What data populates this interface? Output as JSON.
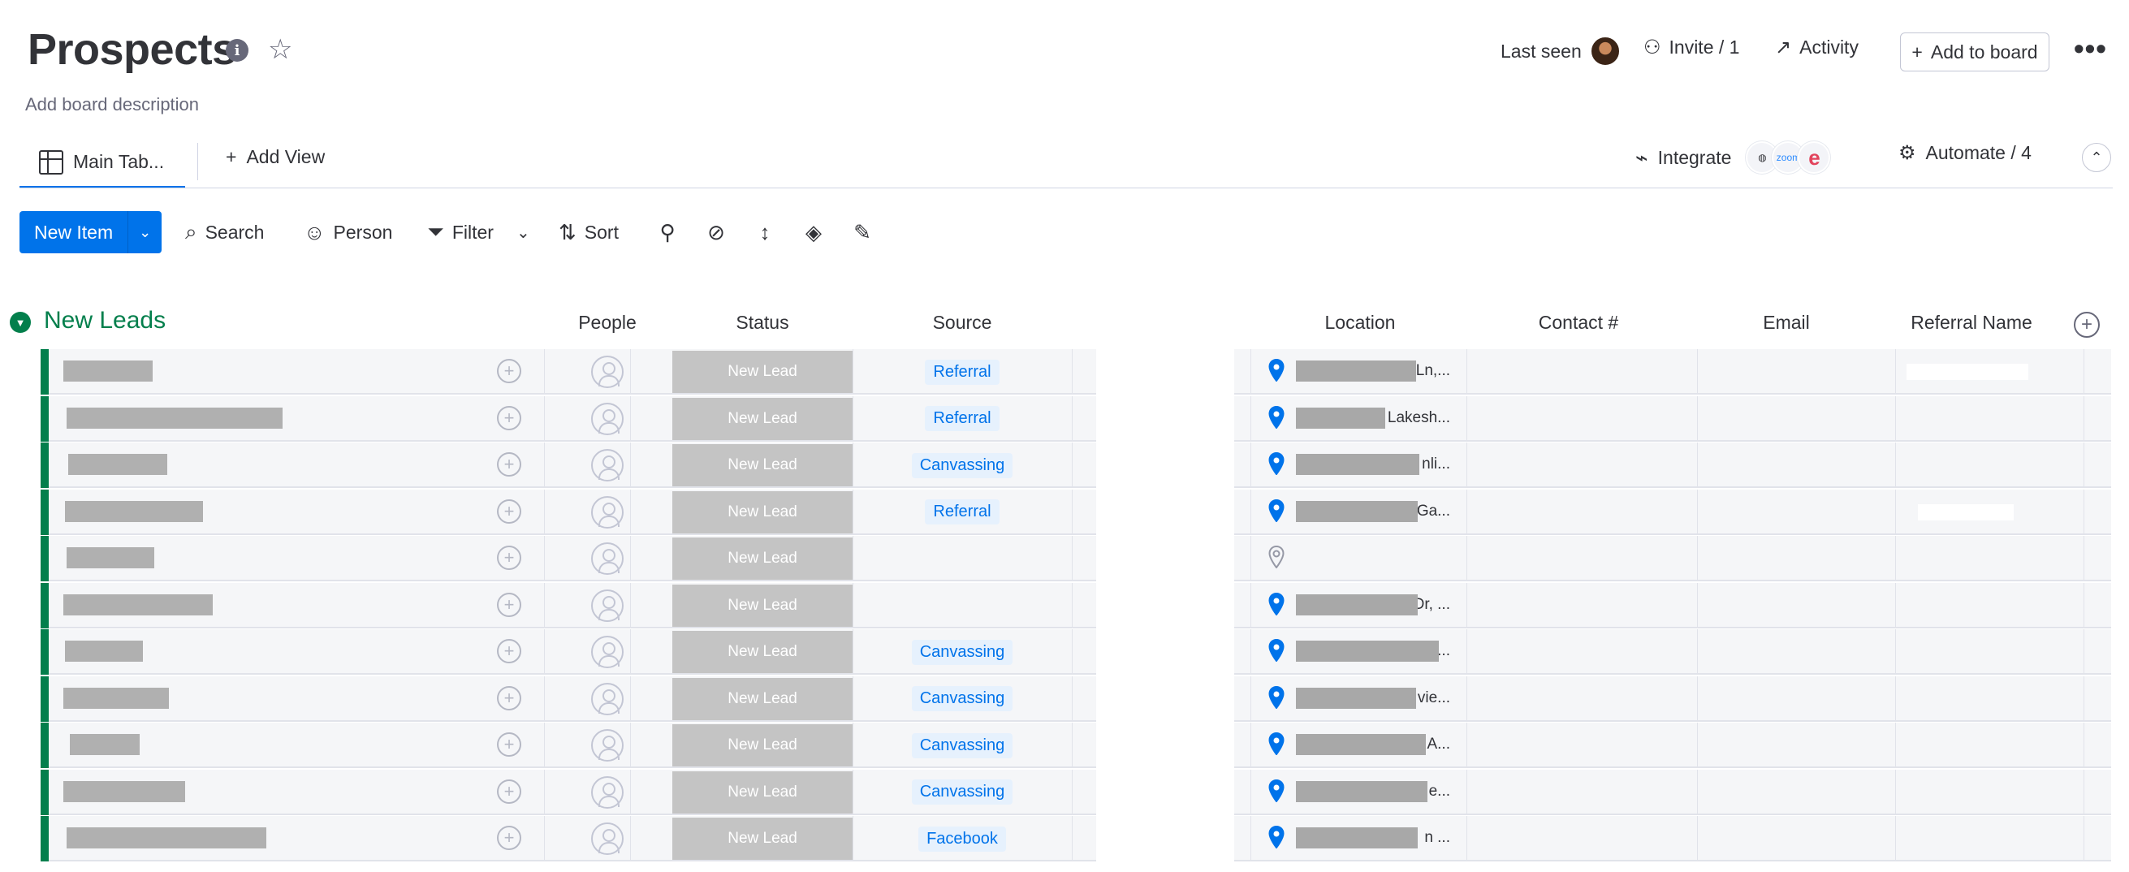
{
  "board": {
    "title": "Prospects",
    "description": "Add board description"
  },
  "header": {
    "last_seen": "Last seen",
    "invite": "Invite / 1",
    "activity": "Activity",
    "add_to_board": "Add to board"
  },
  "views": {
    "main_tab": "Main Tab...",
    "add_view": "Add View",
    "integrate": "Integrate",
    "zoom_badge": "zoom",
    "e_badge": "e",
    "automate": "Automate / 4"
  },
  "toolbar": {
    "new_item": "New Item",
    "search": "Search",
    "person": "Person",
    "filter": "Filter",
    "sort": "Sort"
  },
  "group": {
    "title": "New Leads",
    "columns": {
      "people": "People",
      "status": "Status",
      "source": "Source",
      "location": "Location",
      "contact": "Contact #",
      "email": "Email",
      "referral": "Referral Name"
    },
    "rows": [
      {
        "status": "New Lead",
        "source": "Referral",
        "location_tail": "Ln,...",
        "pin": "filled"
      },
      {
        "status": "New Lead",
        "source": "Referral",
        "location_tail": "Lakesh...",
        "pin": "filled"
      },
      {
        "status": "New Lead",
        "source": "Canvassing",
        "location_tail": "nli...",
        "pin": "filled"
      },
      {
        "status": "New Lead",
        "source": "Referral",
        "location_tail": "Ga...",
        "pin": "filled"
      },
      {
        "status": "New Lead",
        "source": "",
        "location_tail": "",
        "pin": "empty"
      },
      {
        "status": "New Lead",
        "source": "",
        "location_tail": "Dr, ...",
        "pin": "filled"
      },
      {
        "status": "New Lead",
        "source": "Canvassing",
        "location_tail": "...",
        "pin": "filled"
      },
      {
        "status": "New Lead",
        "source": "Canvassing",
        "location_tail": "vie...",
        "pin": "filled"
      },
      {
        "status": "New Lead",
        "source": "Canvassing",
        "location_tail": "A...",
        "pin": "filled"
      },
      {
        "status": "New Lead",
        "source": "Canvassing",
        "location_tail": "e...",
        "pin": "filled"
      },
      {
        "status": "New Lead",
        "source": "Facebook",
        "location_tail": "n ...",
        "pin": "filled"
      }
    ]
  },
  "colors": {
    "primary": "#0073ea",
    "group_green": "#037f4c",
    "status_grey": "#c4c4c4"
  }
}
